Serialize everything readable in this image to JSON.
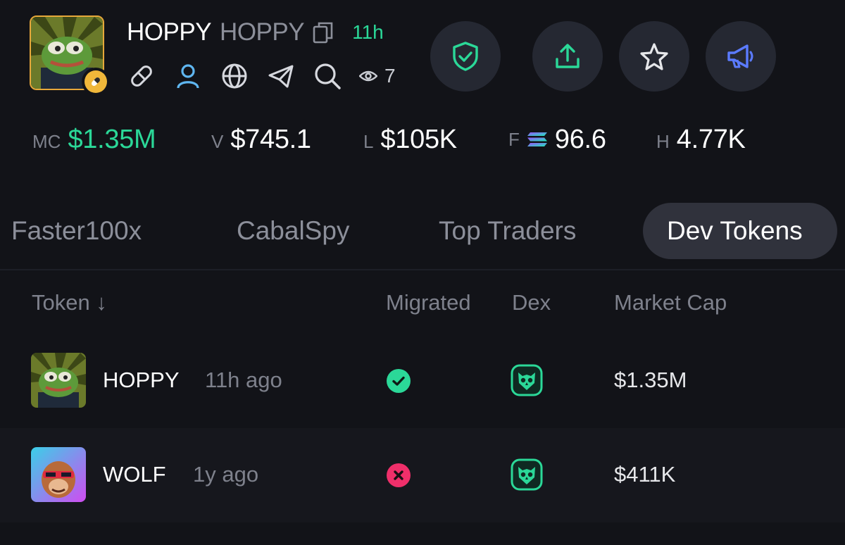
{
  "token": {
    "symbol": "HOPPY",
    "name": "HOPPY",
    "age": "11h",
    "views": "7"
  },
  "header_buttons": [
    {
      "icon": "shield-check-icon",
      "color": "#2bd898"
    },
    {
      "icon": "share-upload-icon",
      "color": "#2bd898"
    },
    {
      "icon": "star-icon",
      "color": "#e6e7ea"
    },
    {
      "icon": "megaphone-icon",
      "color": "#5b7bff"
    }
  ],
  "stats": {
    "mc_label": "MC",
    "mc_value": "$1.35M",
    "v_label": "V",
    "v_value": "$745.1",
    "l_label": "L",
    "l_value": "$105K",
    "f_label": "F",
    "f_value": "96.6",
    "h_label": "H",
    "h_value": "4.77K"
  },
  "tabs": [
    "Faster100x",
    "CabalSpy",
    "Top Traders",
    "Dev Tokens"
  ],
  "active_tab": "Dev Tokens",
  "table": {
    "headers": {
      "token": "Token ↓",
      "migrated": "Migrated",
      "dex": "Dex",
      "market_cap": "Market Cap"
    },
    "rows": [
      {
        "name": "HOPPY",
        "age": "11h ago",
        "migrated": true,
        "dex_icon": "owl-dex-icon",
        "market_cap": "$1.35M"
      },
      {
        "name": "WOLF",
        "age": "1y ago",
        "migrated": false,
        "dex_icon": "owl-dex-icon",
        "market_cap": "$411K"
      }
    ]
  },
  "colors": {
    "background": "#121318",
    "accent_green": "#2bd898",
    "error_pink": "#ef2f6a",
    "muted": "#7e818c"
  }
}
